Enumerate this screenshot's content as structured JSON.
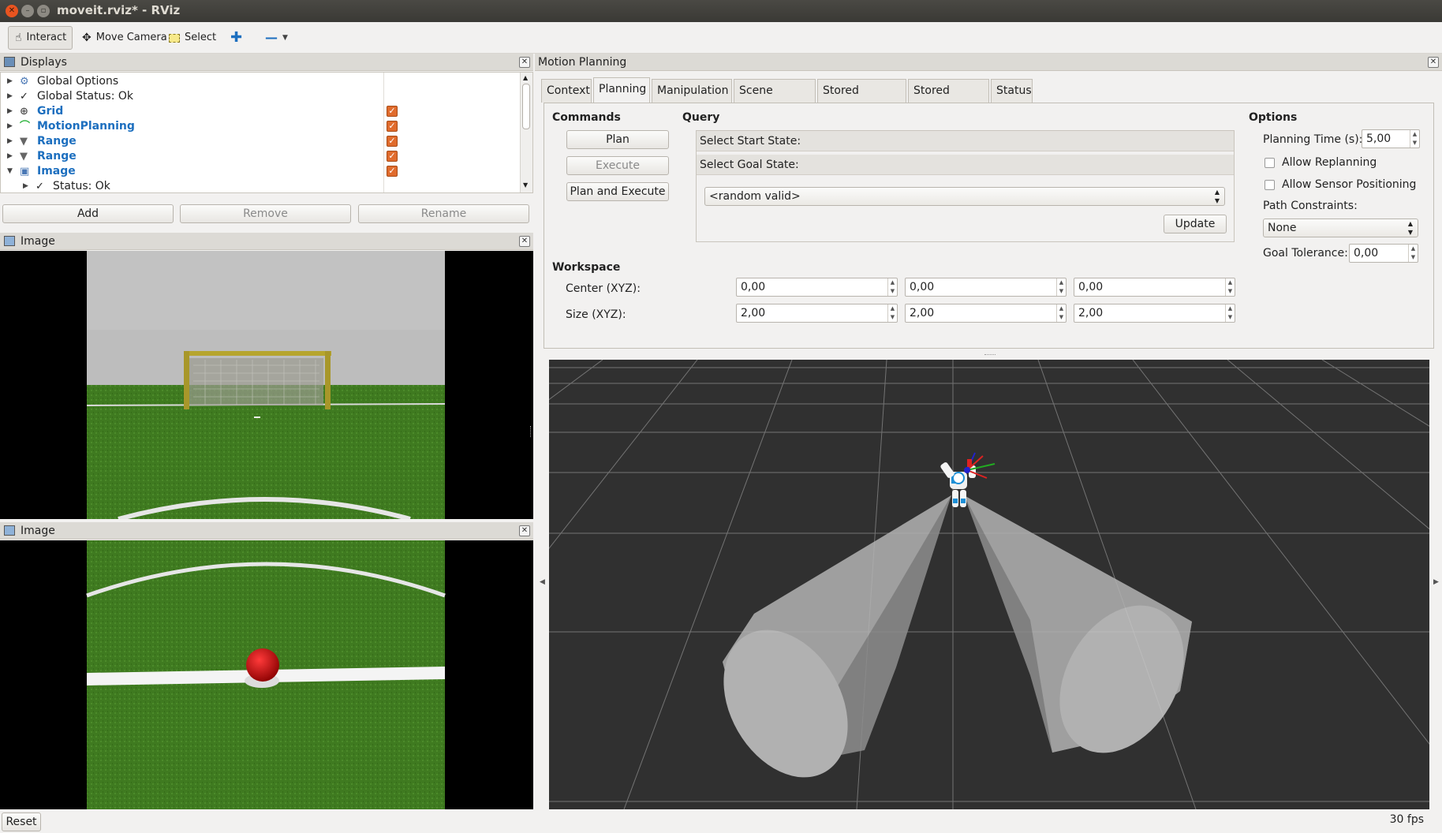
{
  "window": {
    "title": "moveit.rviz* - RViz"
  },
  "toolbar": {
    "interact": "Interact",
    "move_camera": "Move Camera",
    "select": "Select"
  },
  "displays": {
    "title": "Displays",
    "items": [
      {
        "label": "Global Options",
        "style": "normal",
        "icon": "globe-icon",
        "checked": null
      },
      {
        "label": "Global Status: Ok",
        "style": "normal",
        "icon": "checkmark-icon",
        "checked": null
      },
      {
        "label": "Grid",
        "style": "blue",
        "icon": "grid-icon",
        "checked": true
      },
      {
        "label": "MotionPlanning",
        "style": "blue",
        "icon": "motion-planning-icon",
        "checked": true
      },
      {
        "label": "Range",
        "style": "blue",
        "icon": "range-icon",
        "checked": true
      },
      {
        "label": "Range",
        "style": "blue",
        "icon": "range-icon",
        "checked": true
      },
      {
        "label": "Image",
        "style": "blue",
        "icon": "image-icon",
        "checked": true,
        "expanded": true
      },
      {
        "label": "Status: Ok",
        "style": "normal",
        "icon": "checkmark-icon",
        "checked": null,
        "child": true
      }
    ],
    "buttons": {
      "add": "Add",
      "remove": "Remove",
      "rename": "Rename"
    }
  },
  "image_panel_1": {
    "title": "Image"
  },
  "image_panel_2": {
    "title": "Image"
  },
  "motion_planning": {
    "title": "Motion Planning",
    "tabs": [
      "Context",
      "Planning",
      "Manipulation",
      "Scene Objects",
      "Stored Scenes",
      "Stored States",
      "Status"
    ],
    "active_tab": "Planning",
    "commands": {
      "title": "Commands",
      "plan": "Plan",
      "execute": "Execute",
      "plan_and_execute": "Plan and Execute"
    },
    "query": {
      "title": "Query",
      "start_state": "Select Start State:",
      "goal_state": "Select Goal State:",
      "goal_value": "<random valid>",
      "update": "Update"
    },
    "options": {
      "title": "Options",
      "planning_time_label": "Planning Time (s):",
      "planning_time": "5,00",
      "allow_replanning": "Allow Replanning",
      "allow_replanning_checked": false,
      "allow_sensor_positioning": "Allow Sensor Positioning",
      "allow_sensor_positioning_checked": false,
      "path_constraints_label": "Path Constraints:",
      "path_constraints": "None",
      "goal_tolerance_label": "Goal Tolerance:",
      "goal_tolerance": "0,00"
    },
    "workspace": {
      "title": "Workspace",
      "center_label": "Center (XYZ):",
      "center": [
        "0,00",
        "0,00",
        "0,00"
      ],
      "size_label": "Size (XYZ):",
      "size": [
        "2,00",
        "2,00",
        "2,00"
      ]
    }
  },
  "statusbar": {
    "reset": "Reset",
    "fps": "30 fps"
  },
  "colors": {
    "accent_blue": "#1d6fbf",
    "checkbox_orange": "#e06b2c",
    "view_bg": "#303030",
    "field_green": "#3e7a1f"
  }
}
